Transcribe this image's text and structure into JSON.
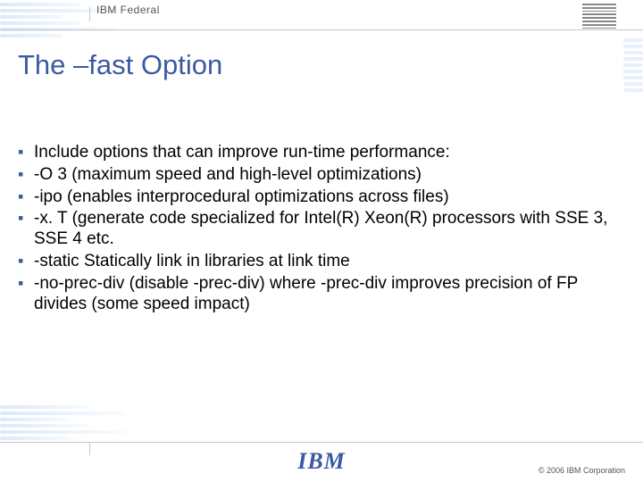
{
  "header": {
    "label": "IBM Federal",
    "logo_name": "ibm-striped-logo"
  },
  "title": "The –fast Option",
  "bullets": [
    "Include options that can improve run-time performance:",
    "-O 3   (maximum speed and high-level optimizations)",
    "-ipo (enables interprocedural optimizations across files)",
    "-x. T  (generate code specialized for Intel(R) Xeon(R) processors with SSE 3, SSE 4 etc.",
    "-static  Statically link in libraries at link time",
    "-no-prec-div (disable -prec-div) where -prec-div improves precision of FP divides (some speed impact)"
  ],
  "footer": {
    "logo_text": "IBM",
    "copyright": "© 2006 IBM Corporation"
  }
}
